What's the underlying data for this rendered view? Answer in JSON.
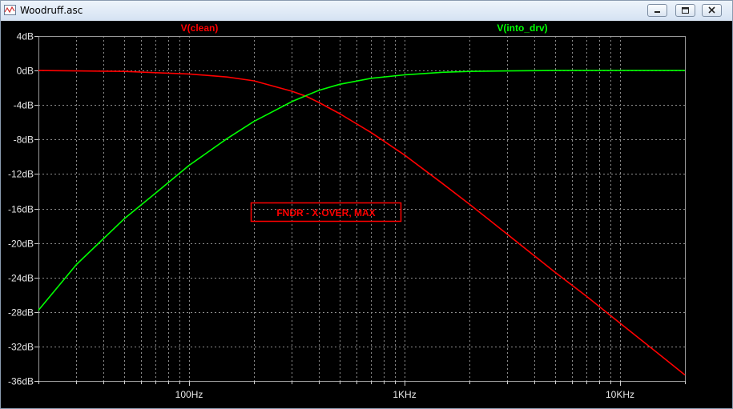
{
  "window": {
    "title": "Woodruff.asc",
    "icons": [
      "waveform-app-icon",
      "minimize-icon",
      "restore-icon",
      "close-icon"
    ]
  },
  "chart_data": {
    "type": "line",
    "x_scale": "log",
    "xlim": [
      20,
      20000
    ],
    "x_unit": "Hz",
    "ylim": [
      -36,
      4
    ],
    "y_unit": "dB",
    "y_ticks": [
      4,
      0,
      -4,
      -8,
      -12,
      -16,
      -20,
      -24,
      -28,
      -32,
      -36
    ],
    "y_tick_labels": [
      "4dB",
      "0dB",
      "-4dB",
      "-8dB",
      "-12dB",
      "-16dB",
      "-20dB",
      "-24dB",
      "-28dB",
      "-32dB",
      "-36dB"
    ],
    "x_ticks": [
      100,
      1000,
      10000
    ],
    "x_tick_labels": [
      "100Hz",
      "1KHz",
      "10KHz"
    ],
    "grid": true,
    "annotation": "FNDR - X-OVER, MAX",
    "annotation_color": "#ff0000",
    "background": "#000000",
    "grid_color": "#8c8c8c",
    "series": [
      {
        "name": "V(clean)",
        "color": "#ff0000",
        "x": [
          20,
          30,
          50,
          70,
          100,
          150,
          200,
          300,
          350,
          400,
          500,
          700,
          1000,
          1500,
          2000,
          3000,
          5000,
          7000,
          10000,
          15000,
          20000
        ],
        "y": [
          0.0,
          -0.05,
          -0.1,
          -0.25,
          -0.4,
          -0.75,
          -1.2,
          -2.4,
          -3.0,
          -3.7,
          -5.0,
          -7.2,
          -9.8,
          -13.1,
          -15.5,
          -19.0,
          -23.4,
          -26.2,
          -29.3,
          -32.8,
          -35.3
        ]
      },
      {
        "name": "V(into_drv)",
        "color": "#00ff00",
        "x": [
          20,
          30,
          50,
          70,
          100,
          150,
          200,
          300,
          350,
          400,
          500,
          700,
          1000,
          1500,
          2000,
          3000,
          5000,
          10000,
          20000
        ],
        "y": [
          -27.8,
          -22.5,
          -17.2,
          -14.2,
          -11.0,
          -7.9,
          -5.9,
          -3.6,
          -2.9,
          -2.3,
          -1.6,
          -0.9,
          -0.5,
          -0.2,
          -0.1,
          -0.05,
          0.0,
          0.0,
          0.0
        ]
      }
    ]
  }
}
